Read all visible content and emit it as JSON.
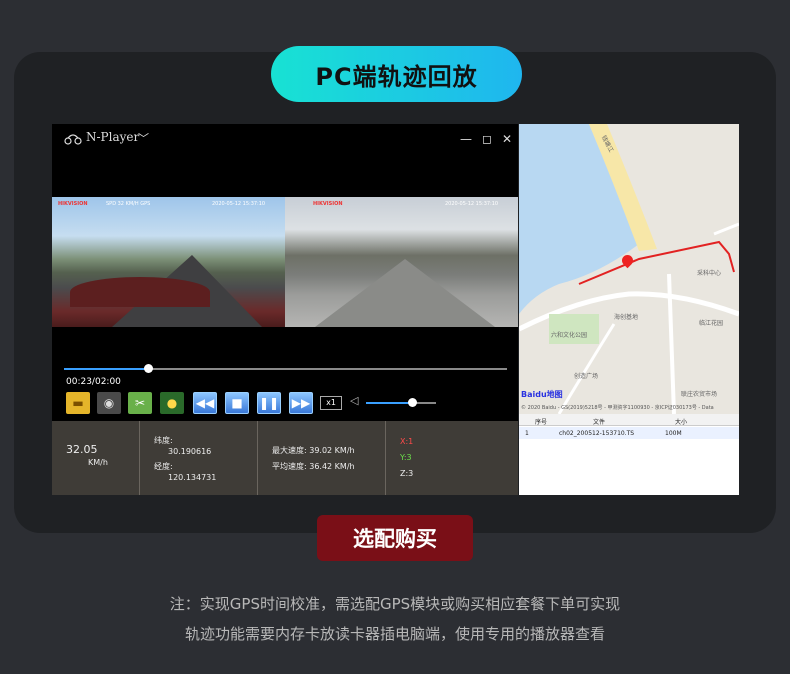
{
  "header": {
    "title": "PC端轨迹回放"
  },
  "player": {
    "app_name": "N-Player",
    "window_controls": {
      "minimize": "—",
      "maximize": "◻",
      "close": "✕"
    },
    "video1": {
      "brand": "HIKVISION",
      "osd": "2020-05-12  15:37:10",
      "left_osd": "SPD 32 KM/H  GPS"
    },
    "video2": {
      "brand": "HIKVISION",
      "osd": "2020-05-12  15:37:10"
    },
    "progress": {
      "time": "00:23/02:00",
      "fraction": 0.19
    },
    "speed_label": "x1",
    "volume_fraction": 0.66,
    "icons": [
      "folder-icon",
      "camera-icon",
      "clip-icon",
      "snapshot-icon",
      "rewind-icon",
      "stop-icon",
      "pause-icon",
      "fast-forward-icon"
    ]
  },
  "info": {
    "speed_value": "32.05",
    "speed_unit": "KM/h",
    "lat_label": "纬度:",
    "lat_value": "30.190616",
    "lon_label": "经度:",
    "lon_value": "120.134731",
    "max_speed": "最大速度: 39.02 KM/h",
    "avg_speed": "平均速度: 36.42 KM/h",
    "x_axis": "X:1",
    "y_axis": "Y:3",
    "z_axis": "Z:3"
  },
  "map": {
    "labels": [
      "钱塘江",
      "采科中心",
      "六和文化公园",
      "海创基地",
      "临江花园",
      "创造广场",
      "联庄农贸市场"
    ],
    "baidu": "Baidu地图",
    "copyright": "© 2020 Baidu - GS(2019)5218号 - 甲测资字1100930 - 京ICP证030173号 - Data"
  },
  "filelist": {
    "headers": [
      "序号",
      "文件",
      "大小"
    ],
    "rows": [
      {
        "index": "1",
        "file": "ch02_200512-153710.TS",
        "size": "100M"
      }
    ]
  },
  "buy_button": "选配购买",
  "notes": [
    "注：实现GPS时间校准，需选配GPS模块或购买相应套餐下单可实现",
    "轨迹功能需要内存卡放读卡器插电脑端，使用专用的播放器查看"
  ],
  "colors": {
    "accent_cyan": "#18e2d3",
    "accent_blue": "#1fb6ef",
    "buy_red": "#7a0f17",
    "track_red": "#e22222"
  }
}
